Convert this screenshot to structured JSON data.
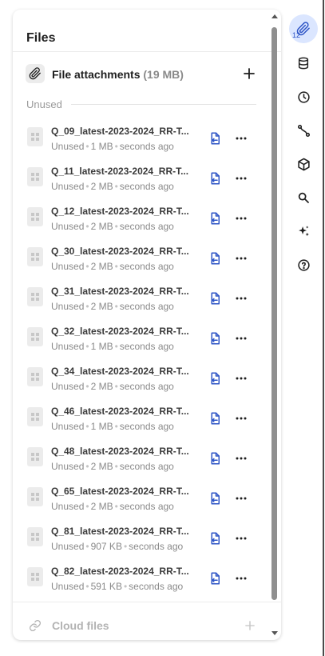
{
  "panel": {
    "title": "Files"
  },
  "attachments": {
    "label": "File attachments",
    "size": "(19 MB)",
    "add_icon": "plus-icon"
  },
  "section": {
    "label": "Unused"
  },
  "files": [
    {
      "name": "Q_09_latest-2023-2024_RR-T...",
      "status": "Unused",
      "size": "1 MB",
      "time": "seconds ago"
    },
    {
      "name": "Q_11_latest-2023-2024_RR-T...",
      "status": "Unused",
      "size": "2 MB",
      "time": "seconds ago"
    },
    {
      "name": "Q_12_latest-2023-2024_RR-T...",
      "status": "Unused",
      "size": "2 MB",
      "time": "seconds ago"
    },
    {
      "name": "Q_30_latest-2023-2024_RR-T...",
      "status": "Unused",
      "size": "2 MB",
      "time": "seconds ago"
    },
    {
      "name": "Q_31_latest-2023-2024_RR-T...",
      "status": "Unused",
      "size": "2 MB",
      "time": "seconds ago"
    },
    {
      "name": "Q_32_latest-2023-2024_RR-T...",
      "status": "Unused",
      "size": "1 MB",
      "time": "seconds ago"
    },
    {
      "name": "Q_34_latest-2023-2024_RR-T...",
      "status": "Unused",
      "size": "2 MB",
      "time": "seconds ago"
    },
    {
      "name": "Q_46_latest-2023-2024_RR-T...",
      "status": "Unused",
      "size": "1 MB",
      "time": "seconds ago"
    },
    {
      "name": "Q_48_latest-2023-2024_RR-T...",
      "status": "Unused",
      "size": "2 MB",
      "time": "seconds ago"
    },
    {
      "name": "Q_65_latest-2023-2024_RR-T...",
      "status": "Unused",
      "size": "2 MB",
      "time": "seconds ago"
    },
    {
      "name": "Q_81_latest-2023-2024_RR-T...",
      "status": "Unused",
      "size": "907 KB",
      "time": "seconds ago"
    },
    {
      "name": "Q_82_latest-2023-2024_RR-T...",
      "status": "Unused",
      "size": "591 KB",
      "time": "seconds ago"
    }
  ],
  "cloud": {
    "label": "Cloud files"
  },
  "rail": {
    "badge": "12",
    "items": [
      {
        "icon": "paperclip-icon",
        "active": true
      },
      {
        "icon": "database-icon"
      },
      {
        "icon": "clock-icon"
      },
      {
        "icon": "workflow-icon"
      },
      {
        "icon": "cube-icon"
      },
      {
        "icon": "search-icon"
      },
      {
        "icon": "sparkles-icon"
      },
      {
        "icon": "help-icon"
      }
    ]
  },
  "colors": {
    "accent": "#2e55c6",
    "rail_active_bg": "#dbe6ff",
    "muted": "#8a8a8a"
  }
}
